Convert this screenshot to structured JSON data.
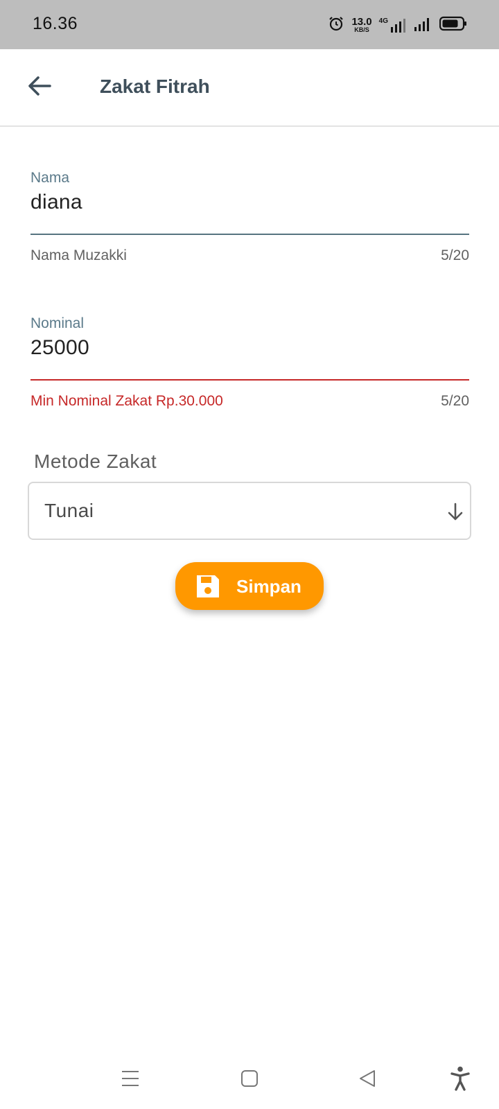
{
  "status_bar": {
    "time": "16.36",
    "net_speed_value": "13.0",
    "net_speed_unit": "KB/S",
    "network_type": "4G"
  },
  "app_bar": {
    "title": "Zakat Fitrah",
    "back_icon": "arrow-left-icon"
  },
  "form": {
    "nama": {
      "label": "Nama",
      "value": "diana",
      "helper": "Nama Muzakki",
      "counter": "5/20"
    },
    "nominal": {
      "label": "Nominal",
      "value": "25000",
      "error": "Min Nominal Zakat Rp.30.000",
      "counter": "5/20"
    },
    "metode": {
      "label": "Metode Zakat",
      "selected": "Tunai",
      "arrow_icon": "arrow-down-icon"
    },
    "save_button": {
      "label": "Simpan",
      "icon": "save-icon"
    }
  },
  "colors": {
    "accent": "#ff9800",
    "error": "#c62828",
    "field_line": "#567380",
    "title": "#3f4f5b"
  },
  "nav_bar": {
    "icons": [
      "menu-icon",
      "home-icon",
      "back-triangle-icon",
      "accessibility-icon"
    ]
  }
}
